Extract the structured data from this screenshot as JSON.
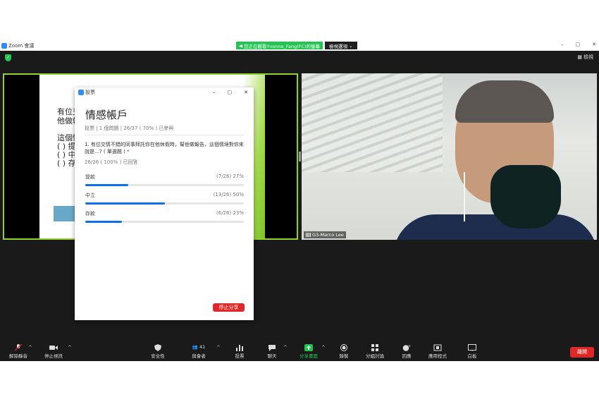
{
  "app": {
    "title": "Zoom 會議"
  },
  "banner": {
    "viewing": "您正在觀看Yvonne_Fang(FC)的螢幕",
    "view_options": "檢視選項"
  },
  "header": {
    "gallery": "檢視"
  },
  "slide": {
    "lines": [
      "有位交",
      "他做報",
      "",
      "這個情",
      "( ) 提",
      "( ) 中",
      "( ) 存"
    ]
  },
  "camera": {
    "name": "G3-Marco Lee"
  },
  "poll": {
    "window_title": "投票",
    "title": "情感帳戶",
    "meta": "投票 | 1 個問題 | 26/37 ( 70% ) 已參與",
    "question": "1. 有位交情不錯的同事拜託你在他休假時，幫他做報告，這個情境對你來說是…? ( 單選題 )",
    "required_mark": "*",
    "answered": "26/26 ( 100% ) 已回答",
    "options": [
      {
        "label": "提款",
        "result": "(7/26) 27%",
        "fraction": 0.27
      },
      {
        "label": "中立",
        "result": "(13/26) 50%",
        "fraction": 0.5
      },
      {
        "label": "存款",
        "result": "(6/26) 23%",
        "fraction": 0.23
      }
    ],
    "stop_button": "停止分享"
  },
  "toolbar": {
    "unmute": "解除靜音",
    "stop_video": "停止視訊",
    "security": "安全性",
    "participants": "與會者",
    "participants_count": "41",
    "polls": "投票",
    "chat": "聊天",
    "share": "分享畫面",
    "record": "錄製",
    "breakout": "分組討論",
    "reactions": "回應",
    "apps": "應用程式",
    "whiteboard": "白板",
    "end": "離開"
  },
  "colors": {
    "accent": "#0e71eb",
    "danger": "#e02828",
    "share_green": "#23c552",
    "slide_border": "#8fd130"
  }
}
